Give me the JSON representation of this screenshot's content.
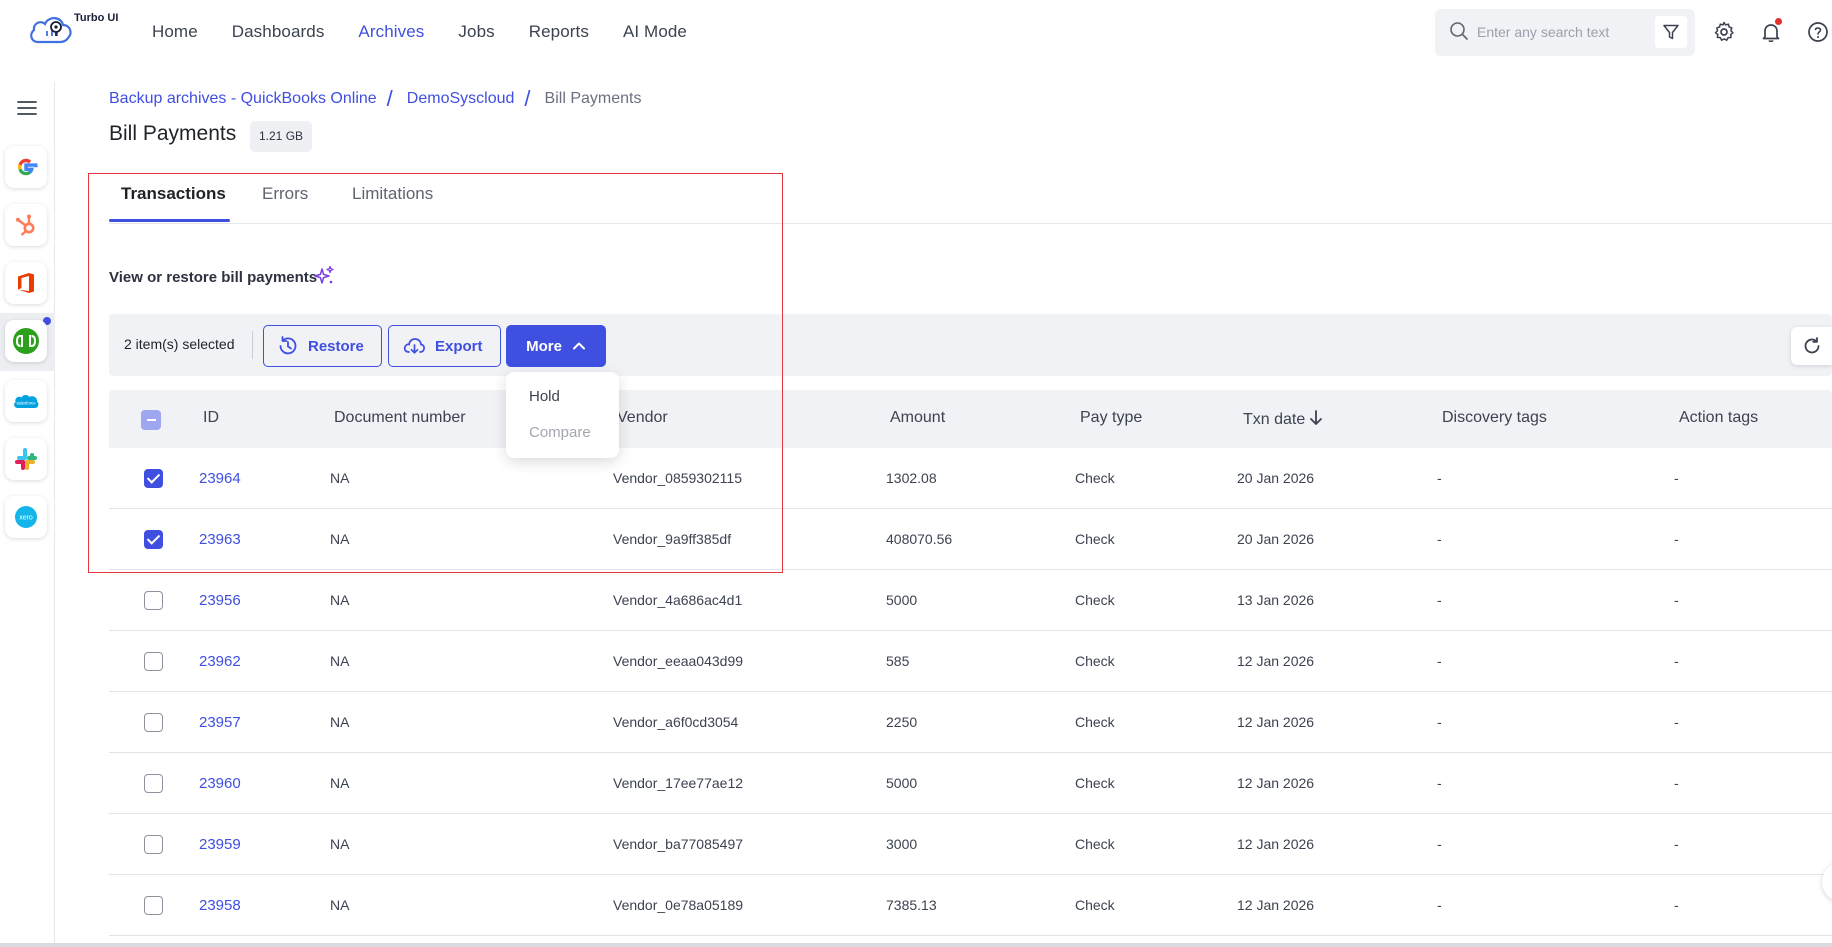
{
  "app": {
    "logo_text": "Turbo UI"
  },
  "nav": {
    "items": [
      "Home",
      "Dashboards",
      "Archives",
      "Jobs",
      "Reports",
      "AI Mode"
    ],
    "active": "Archives"
  },
  "search": {
    "placeholder": "Enter any search text"
  },
  "sidebar_apps": [
    "google-icon",
    "hubspot-icon",
    "office-icon",
    "quickbooks-icon",
    "salesforce-icon",
    "slack-icon",
    "xero-icon"
  ],
  "breadcrumb": {
    "level1": "Backup archives -  QuickBooks Online",
    "level2": "DemoSyscloud",
    "current": "Bill Payments"
  },
  "page": {
    "title": "Bill Payments",
    "size": "1.21 GB",
    "subtitle": "View or restore bill payments"
  },
  "tabs": [
    "Transactions",
    "Errors",
    "Limitations"
  ],
  "actions": {
    "selected": "2 item(s) selected",
    "restore": "Restore",
    "export": "Export",
    "more": "More"
  },
  "more_menu": {
    "hold": "Hold",
    "compare": "Compare"
  },
  "table": {
    "headers": {
      "id": "ID",
      "doc": "Document number",
      "vendor": "Vendor",
      "amount": "Amount",
      "paytype": "Pay type",
      "txndate": "Txn date",
      "discovery": "Discovery tags",
      "action": "Action tags"
    },
    "rows": [
      {
        "checked": true,
        "id": "23964",
        "doc": "NA",
        "vendor": "Vendor_0859302115",
        "amount": "1302.08",
        "paytype": "Check",
        "date": "20 Jan 2026",
        "discovery": "-",
        "action": "-"
      },
      {
        "checked": true,
        "id": "23963",
        "doc": "NA",
        "vendor": "Vendor_9a9ff385df",
        "amount": "408070.56",
        "paytype": "Check",
        "date": "20 Jan 2026",
        "discovery": "-",
        "action": "-"
      },
      {
        "checked": false,
        "id": "23956",
        "doc": "NA",
        "vendor": "Vendor_4a686ac4d1",
        "amount": "5000",
        "paytype": "Check",
        "date": "13 Jan 2026",
        "discovery": "-",
        "action": "-"
      },
      {
        "checked": false,
        "id": "23962",
        "doc": "NA",
        "vendor": "Vendor_eeaa043d99",
        "amount": "585",
        "paytype": "Check",
        "date": "12 Jan 2026",
        "discovery": "-",
        "action": "-"
      },
      {
        "checked": false,
        "id": "23957",
        "doc": "NA",
        "vendor": "Vendor_a6f0cd3054",
        "amount": "2250",
        "paytype": "Check",
        "date": "12 Jan 2026",
        "discovery": "-",
        "action": "-"
      },
      {
        "checked": false,
        "id": "23960",
        "doc": "NA",
        "vendor": "Vendor_17ee77ae12",
        "amount": "5000",
        "paytype": "Check",
        "date": "12 Jan 2026",
        "discovery": "-",
        "action": "-"
      },
      {
        "checked": false,
        "id": "23959",
        "doc": "NA",
        "vendor": "Vendor_ba77085497",
        "amount": "3000",
        "paytype": "Check",
        "date": "12 Jan 2026",
        "discovery": "-",
        "action": "-"
      },
      {
        "checked": false,
        "id": "23958",
        "doc": "NA",
        "vendor": "Vendor_0e78a05189",
        "amount": "7385.13",
        "paytype": "Check",
        "date": "12 Jan 2026",
        "discovery": "-",
        "action": "-"
      }
    ]
  },
  "colors": {
    "accent": "#3f4fe0",
    "highlight": "#e0383c",
    "notification": "#e0302f"
  }
}
